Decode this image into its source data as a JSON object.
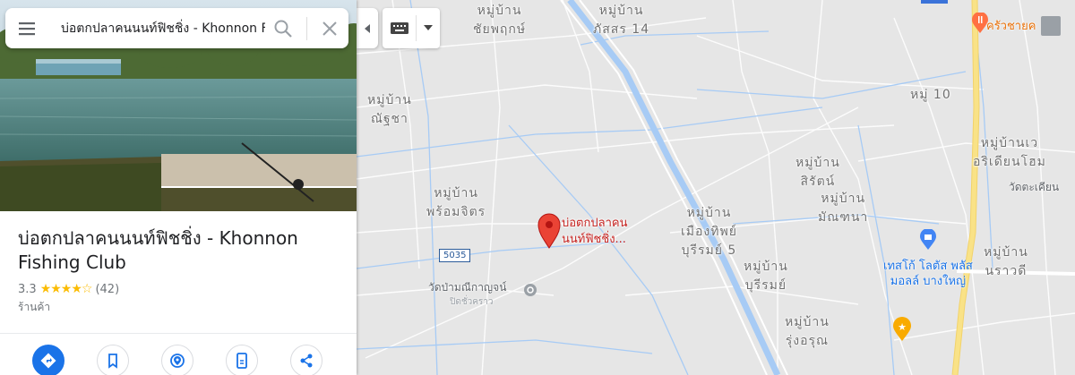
{
  "search": {
    "value": "บ่อตกปลาคนนนท์ฟิชชิ่ง - Khonnon Fishing Club",
    "menu_icon": "menu-icon",
    "search_icon": "search-icon",
    "close_icon": "close-icon"
  },
  "place": {
    "title": "บ่อตกปลาคนนนท์ฟิชชิ่ง - Khonnon Fishing Club",
    "rating": "3.3",
    "stars": "★★★★☆",
    "review_count": "(42)",
    "category": "ร้านค้า",
    "rating_value": 3.3
  },
  "actions": [
    {
      "icon": "directions-icon"
    },
    {
      "icon": "bookmark-icon"
    },
    {
      "icon": "nearby-icon"
    },
    {
      "icon": "send-to-phone-icon"
    },
    {
      "icon": "share-icon"
    }
  ],
  "map": {
    "labels": {
      "chaiyaphruk": "หมู่บ้าน\nชัยพฤกษ์",
      "phatsorn": "หมู่บ้าน\nภัสสร 14",
      "natcha": "หมู่บ้าน\nณัฐชา",
      "phromjit": "หมู่บ้าน\nพร้อมจิตร",
      "muangthip": "หมู่บ้าน\nเมืองทิพย์\nบุรีรมย์ 5",
      "burirom": "หมู่บ้าน\nบุรีรมย์",
      "sirat": "หมู่บ้าน\nสิรัตน์",
      "manthana": "หมู่บ้าน\nมัณฑนา",
      "moo10": "หมู่ 10",
      "riverian": "หมู่บ้านเว\nอริเดียนโฮม",
      "narawadee": "หมู่บ้าน\nนราวดี",
      "rungarun": "หมู่บ้าน\nรุ่งอรุณ"
    },
    "pin_label": "บ่อตกปลาคน\nนนท์ฟิชชิ่ง...",
    "temple": "วัดป่ามณีกาญจน์",
    "temple_status": "ปิดชั่วคราว",
    "temple_top": "วัดตะเคียน",
    "tesco": "เทสโก้ โลตัส พลัส\nมอลล์ บางใหญ่",
    "restaurant": "ครัวชายค",
    "road_shield": "5035",
    "colors": {
      "water": "#a7cbf5",
      "road": "#ffffff",
      "highway": "#f9e287",
      "pin": "#ea4335",
      "poi_label": "#c5221f"
    }
  }
}
